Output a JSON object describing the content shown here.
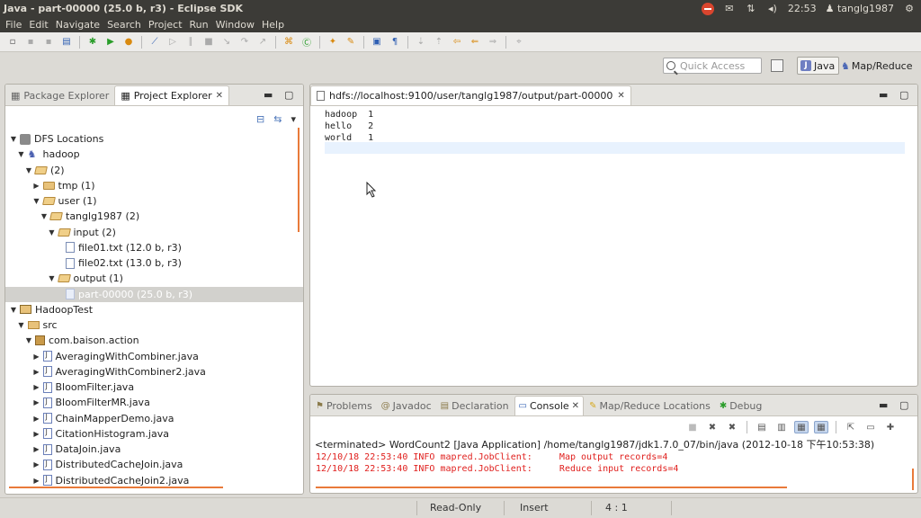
{
  "window": {
    "title": "Java - part-00000 (25.0 b, r3) - Eclipse SDK"
  },
  "tray": {
    "clock": "22:53",
    "user": "tanglg1987"
  },
  "menubar": [
    "File",
    "Edit",
    "Navigate",
    "Search",
    "Project",
    "Run",
    "Window",
    "Help"
  ],
  "quick_access": {
    "placeholder": "Quick Access"
  },
  "perspectives": {
    "java": "Java",
    "mapreduce": "Map/Reduce"
  },
  "left_panel": {
    "tabs": [
      "Package Explorer",
      "Project Explorer"
    ],
    "active_tab": "Project Explorer",
    "tree": [
      {
        "label": "DFS Locations",
        "level": 0,
        "icon": "dfs-locations-icon",
        "expanded": true
      },
      {
        "label": "hadoop",
        "level": 1,
        "icon": "elephant-icon",
        "expanded": true
      },
      {
        "label": "(2)",
        "level": 2,
        "icon": "folder-open-icon",
        "expanded": true
      },
      {
        "label": "tmp (1)",
        "level": 3,
        "icon": "folder-icon",
        "expanded": false
      },
      {
        "label": "user (1)",
        "level": 3,
        "icon": "folder-open-icon",
        "expanded": true
      },
      {
        "label": "tanglg1987 (2)",
        "level": 4,
        "icon": "folder-open-icon",
        "expanded": true
      },
      {
        "label": "input (2)",
        "level": 5,
        "icon": "folder-open-icon",
        "expanded": true
      },
      {
        "label": "file01.txt (12.0 b, r3)",
        "level": 6,
        "icon": "file-icon"
      },
      {
        "label": "file02.txt (13.0 b, r3)",
        "level": 6,
        "icon": "file-icon"
      },
      {
        "label": "output (1)",
        "level": 5,
        "icon": "folder-open-icon",
        "expanded": true
      },
      {
        "label": "part-00000 (25.0 b, r3)",
        "level": 6,
        "icon": "file-icon",
        "selected": true
      },
      {
        "label": "HadoopTest",
        "level": 0,
        "icon": "project-icon",
        "expanded": true
      },
      {
        "label": "src",
        "level": 1,
        "icon": "src-folder-icon",
        "expanded": true
      },
      {
        "label": "com.baison.action",
        "level": 2,
        "icon": "package-icon",
        "expanded": true
      },
      {
        "label": "AveragingWithCombiner.java",
        "level": 3,
        "icon": "java-file-icon",
        "expanded": false
      },
      {
        "label": "AveragingWithCombiner2.java",
        "level": 3,
        "icon": "java-file-icon",
        "expanded": false
      },
      {
        "label": "BloomFilter.java",
        "level": 3,
        "icon": "java-file-icon",
        "expanded": false
      },
      {
        "label": "BloomFilterMR.java",
        "level": 3,
        "icon": "java-file-icon",
        "expanded": false
      },
      {
        "label": "ChainMapperDemo.java",
        "level": 3,
        "icon": "java-file-icon",
        "expanded": false
      },
      {
        "label": "CitationHistogram.java",
        "level": 3,
        "icon": "java-file-icon",
        "expanded": false
      },
      {
        "label": "DataJoin.java",
        "level": 3,
        "icon": "java-file-icon",
        "expanded": false
      },
      {
        "label": "DistributedCacheJoin.java",
        "level": 3,
        "icon": "java-file-icon",
        "expanded": false
      },
      {
        "label": "DistributedCacheJoin2.java",
        "level": 3,
        "icon": "java-file-icon",
        "expanded": false
      }
    ]
  },
  "editor": {
    "tab_title": "hdfs://localhost:9100/user/tanglg1987/output/part-00000",
    "lines": [
      "hadoop  1",
      "hello   2",
      "world   1"
    ]
  },
  "console": {
    "tabs": [
      "Problems",
      "Javadoc",
      "Declaration",
      "Console",
      "Map/Reduce Locations",
      "Debug"
    ],
    "active_tab": "Console",
    "header": "<terminated> WordCount2 [Java Application] /home/tanglg1987/jdk1.7.0_07/bin/java (2012-10-18 下午10:53:38)",
    "lines": [
      "12/10/18 22:53:40 INFO mapred.JobClient:     Map output records=4",
      "12/10/18 22:53:40 INFO mapred.JobClient:     Reduce input records=4"
    ]
  },
  "status_bar": {
    "mode": "Read-Only",
    "insert": "Insert",
    "position": "4 : 1"
  },
  "colors": {
    "error_text": "#e0201e",
    "selection_bg": "#d2d1cd",
    "scroll_accent": "#e97a3a"
  }
}
